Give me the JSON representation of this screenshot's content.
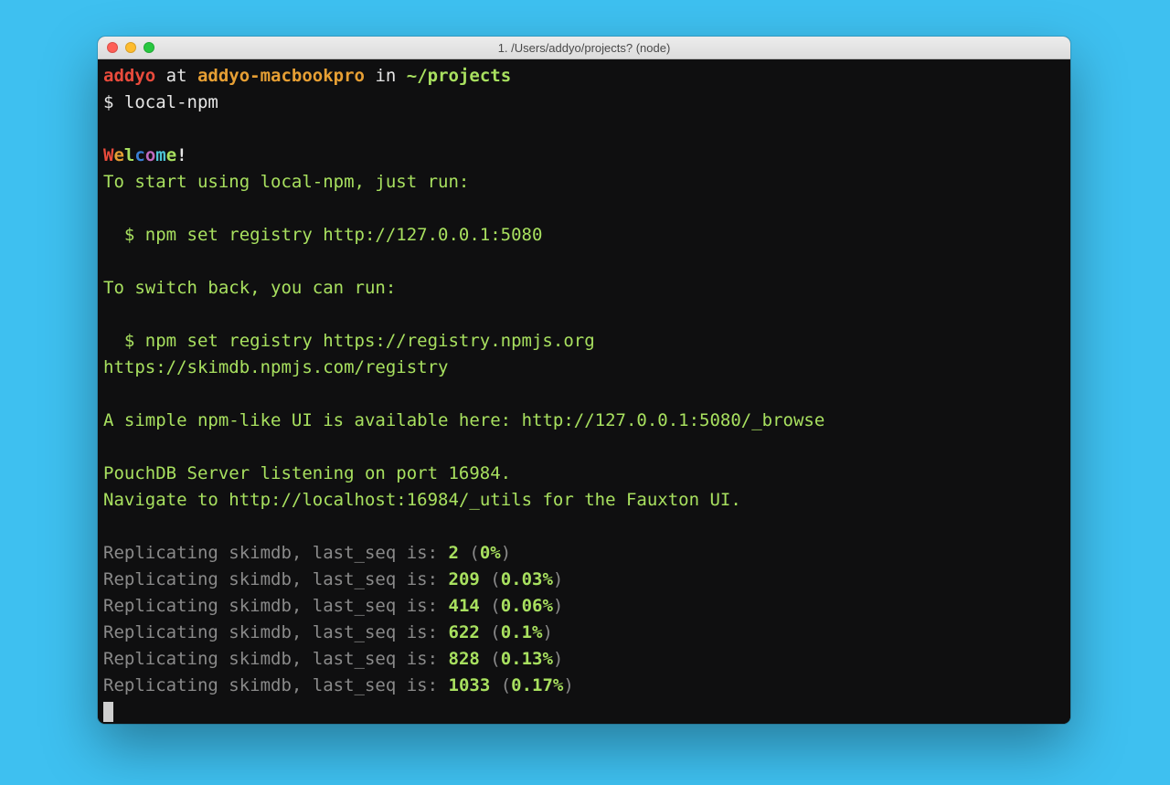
{
  "window": {
    "title": "1. /Users/addyo/projects? (node)"
  },
  "prompt": {
    "user": "addyo",
    "at": " at ",
    "host": "addyo-macbookpro",
    "in": " in ",
    "path": "~/projects",
    "symbol": "$ ",
    "command": "local-npm"
  },
  "welcome": {
    "chars": [
      "W",
      "e",
      "l",
      "c",
      "o",
      "m",
      "e",
      "!"
    ],
    "colors": [
      "c-red",
      "c-orange",
      "c-green",
      "c-blue",
      "c-mag",
      "c-cyan",
      "c-green",
      "c-white"
    ]
  },
  "body": {
    "start": "To start using local-npm, just run:",
    "cmd1a": "  $ npm set registry ",
    "cmd1b": "http://127.0.0.1:5080",
    "switch": "To switch back, you can run:",
    "cmd2a": "  $ npm set registry ",
    "cmd2b": "https://registry.npmjs.org",
    "skim": "https://skimdb.npmjs.com/registry",
    "ui_a": "A simple npm-like UI is available here: ",
    "ui_b": "http://127.0.0.1:5080/_browse",
    "pouch": "PouchDB Server listening on port 16984.",
    "nav_a": "Navigate to ",
    "nav_b": "http://localhost:16984/_utils",
    "nav_c": " for the Fauxton UI."
  },
  "replication": {
    "prefix": "Replicating skimdb, last_seq is: ",
    "rows": [
      {
        "seq": "2",
        "pct": "0%"
      },
      {
        "seq": "209",
        "pct": "0.03%"
      },
      {
        "seq": "414",
        "pct": "0.06%"
      },
      {
        "seq": "622",
        "pct": "0.1%"
      },
      {
        "seq": "828",
        "pct": "0.13%"
      },
      {
        "seq": "1033",
        "pct": "0.17%"
      }
    ]
  }
}
